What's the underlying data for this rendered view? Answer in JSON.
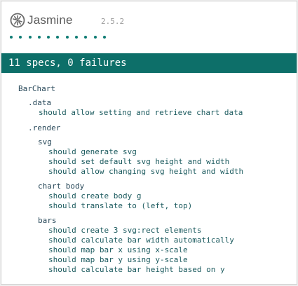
{
  "header": {
    "logo_text": "Jasmine",
    "version": "2.5.2",
    "dot_count": 11
  },
  "summary": {
    "text": "11 specs, 0 failures"
  },
  "colors": {
    "accent": "#0d6f69",
    "dot": "#0d7b73",
    "suite_text": "#29495a",
    "spec_text": "#1b5a5e"
  },
  "suites": {
    "root": {
      "title": "BarChart"
    },
    "data": {
      "title": ".data",
      "specs": [
        "should allow setting and retrieve chart data"
      ]
    },
    "render": {
      "title": ".render"
    },
    "svg": {
      "title": "svg",
      "specs": [
        "should generate svg",
        "should set default svg height and width",
        "should allow changing svg height and width"
      ]
    },
    "chart_body": {
      "title": "chart body",
      "specs": [
        "should create body g",
        "should translate to (left, top)"
      ]
    },
    "bars": {
      "title": "bars",
      "specs": [
        "should create 3 svg:rect elements",
        "should calculate bar width automatically",
        "should map bar x using x-scale",
        "should map bar y using y-scale",
        "should calculate bar height based on y"
      ]
    }
  }
}
